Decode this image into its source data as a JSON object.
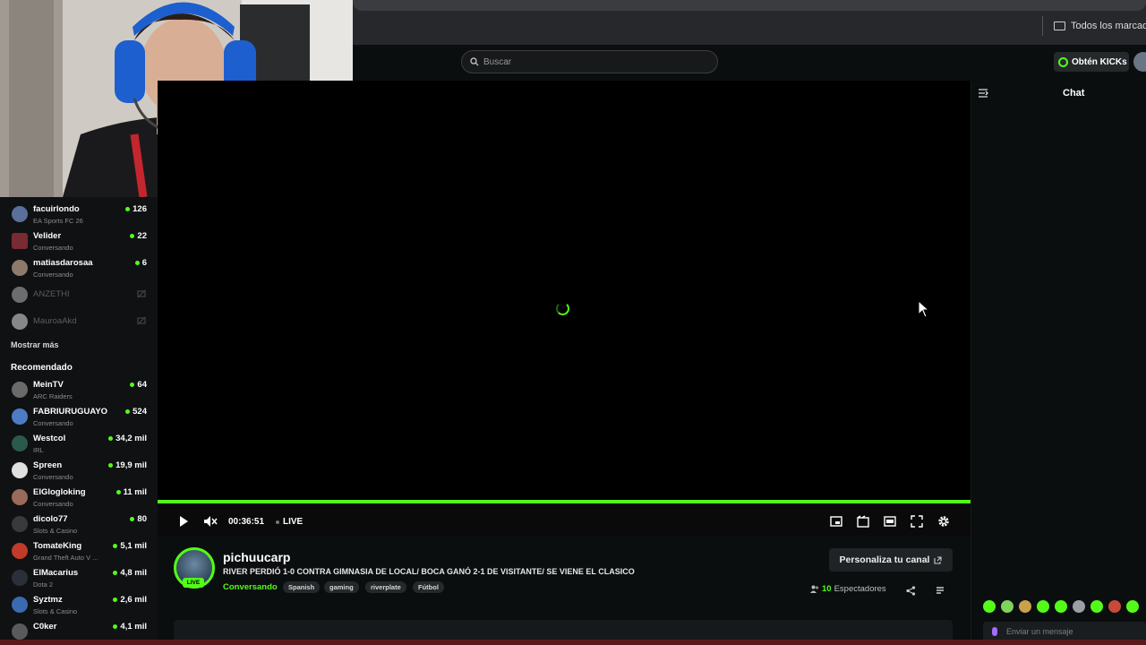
{
  "browser": {
    "bookmarks_label": "Todos los marcadores"
  },
  "header": {
    "search_placeholder": "Buscar",
    "kicks_button": "Obtén KICKs"
  },
  "sidebar": {
    "following": [
      {
        "name": "facuirlondo",
        "category": "EA Sports FC 26",
        "viewers": "126",
        "online": true
      },
      {
        "name": "Velider",
        "category": "Conversando",
        "viewers": "22",
        "online": true
      },
      {
        "name": "matiasdarosaa",
        "category": "Conversando",
        "viewers": "6",
        "online": true
      },
      {
        "name": "ANZETHI",
        "online": false
      },
      {
        "name": "MauroaAkd",
        "online": false
      }
    ],
    "show_more": "Mostrar más",
    "recommended_title": "Recomendado",
    "recommended": [
      {
        "name": "MeinTV",
        "category": "ARC Raiders",
        "viewers": "64"
      },
      {
        "name": "FABRIURUGUAYO",
        "category": "Conversando",
        "viewers": "524"
      },
      {
        "name": "Westcol",
        "category": "IRL",
        "viewers": "34,2 mil"
      },
      {
        "name": "Spreen",
        "category": "Conversando",
        "viewers": "19,9 mil"
      },
      {
        "name": "ElGlogloking",
        "category": "Conversando",
        "viewers": "11 mil"
      },
      {
        "name": "dicolo77",
        "category": "Slots & Casino",
        "viewers": "80"
      },
      {
        "name": "TomateKing",
        "category": "Grand Theft Auto V ...",
        "viewers": "5,1 mil"
      },
      {
        "name": "ElMacarius",
        "category": "Dota 2",
        "viewers": "4,8 mil"
      },
      {
        "name": "Syztmz",
        "category": "Slots & Casino",
        "viewers": "2,6 mil"
      },
      {
        "name": "C0ker",
        "category": "",
        "viewers": "4,1 mil"
      }
    ]
  },
  "player": {
    "timecode": "00:36:51",
    "live_label": "LIVE"
  },
  "stream": {
    "live_badge": "LIVE",
    "channel_name": "pichuucarp",
    "title": "RIVER PERDIÓ 1-0 CONTRA GIMNASIA DE LOCAL/ BOCA GANÓ 2-1 DE VISITANTE/ SE VIENE EL CLASICO",
    "category": "Conversando",
    "tags": [
      "Spanish",
      "gaming",
      "riverplate",
      "Fútbol"
    ],
    "customize_button": "Personaliza tu canal",
    "viewer_count": "10",
    "viewer_label": "Espectadores"
  },
  "chat": {
    "title": "Chat",
    "input_placeholder": "Enviar un mensaje"
  },
  "colors": {
    "accent": "#53fc18",
    "background": "#0b0e0f",
    "sidebar": "#0f1113"
  }
}
